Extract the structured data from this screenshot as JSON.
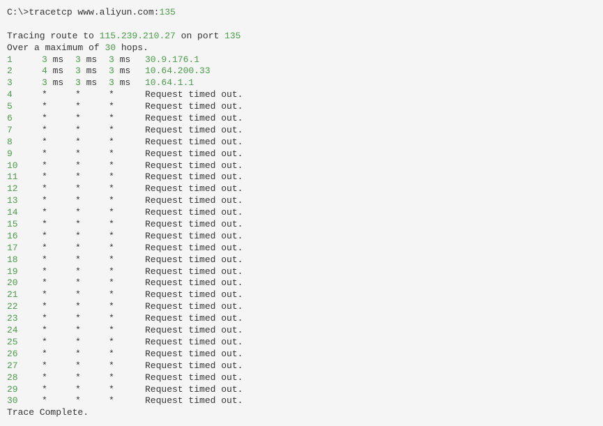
{
  "command": {
    "prompt": "C:\\>",
    "cmd": "tracetcp www.aliyun.com:",
    "port": "135"
  },
  "tracing": {
    "prefix": "Tracing route to ",
    "ip": "115.239.210.27",
    "mid": " on port ",
    "port": "135"
  },
  "maxhops": {
    "prefix": "Over a maximum of ",
    "num": "30",
    "suffix": " hops."
  },
  "hops": [
    {
      "n": "1",
      "c1": "3",
      "u1": "ms",
      "c2": "3",
      "u2": "ms",
      "c3": "3",
      "u3": "ms",
      "r": "30.9.176.1",
      "rg": true
    },
    {
      "n": "2",
      "c1": "4",
      "u1": "ms",
      "c2": "3",
      "u2": "ms",
      "c3": "3",
      "u3": "ms",
      "r": "10.64.200.33",
      "rg": true
    },
    {
      "n": "3",
      "c1": "3",
      "u1": "ms",
      "c2": "3",
      "u2": "ms",
      "c3": "3",
      "u3": "ms",
      "r": "10.64.1.1",
      "rg": true
    },
    {
      "n": "4",
      "c1": "*",
      "u1": "",
      "c2": "*",
      "u2": "",
      "c3": "*",
      "u3": "",
      "r": "Request timed out.",
      "rg": false
    },
    {
      "n": "5",
      "c1": "*",
      "u1": "",
      "c2": "*",
      "u2": "",
      "c3": "*",
      "u3": "",
      "r": "Request timed out.",
      "rg": false
    },
    {
      "n": "6",
      "c1": "*",
      "u1": "",
      "c2": "*",
      "u2": "",
      "c3": "*",
      "u3": "",
      "r": "Request timed out.",
      "rg": false
    },
    {
      "n": "7",
      "c1": "*",
      "u1": "",
      "c2": "*",
      "u2": "",
      "c3": "*",
      "u3": "",
      "r": "Request timed out.",
      "rg": false
    },
    {
      "n": "8",
      "c1": "*",
      "u1": "",
      "c2": "*",
      "u2": "",
      "c3": "*",
      "u3": "",
      "r": "Request timed out.",
      "rg": false
    },
    {
      "n": "9",
      "c1": "*",
      "u1": "",
      "c2": "*",
      "u2": "",
      "c3": "*",
      "u3": "",
      "r": "Request timed out.",
      "rg": false
    },
    {
      "n": "10",
      "c1": "*",
      "u1": "",
      "c2": "*",
      "u2": "",
      "c3": "*",
      "u3": "",
      "r": "Request timed out.",
      "rg": false
    },
    {
      "n": "11",
      "c1": "*",
      "u1": "",
      "c2": "*",
      "u2": "",
      "c3": "*",
      "u3": "",
      "r": "Request timed out.",
      "rg": false
    },
    {
      "n": "12",
      "c1": "*",
      "u1": "",
      "c2": "*",
      "u2": "",
      "c3": "*",
      "u3": "",
      "r": "Request timed out.",
      "rg": false
    },
    {
      "n": "13",
      "c1": "*",
      "u1": "",
      "c2": "*",
      "u2": "",
      "c3": "*",
      "u3": "",
      "r": "Request timed out.",
      "rg": false
    },
    {
      "n": "14",
      "c1": "*",
      "u1": "",
      "c2": "*",
      "u2": "",
      "c3": "*",
      "u3": "",
      "r": "Request timed out.",
      "rg": false
    },
    {
      "n": "15",
      "c1": "*",
      "u1": "",
      "c2": "*",
      "u2": "",
      "c3": "*",
      "u3": "",
      "r": "Request timed out.",
      "rg": false
    },
    {
      "n": "16",
      "c1": "*",
      "u1": "",
      "c2": "*",
      "u2": "",
      "c3": "*",
      "u3": "",
      "r": "Request timed out.",
      "rg": false
    },
    {
      "n": "17",
      "c1": "*",
      "u1": "",
      "c2": "*",
      "u2": "",
      "c3": "*",
      "u3": "",
      "r": "Request timed out.",
      "rg": false
    },
    {
      "n": "18",
      "c1": "*",
      "u1": "",
      "c2": "*",
      "u2": "",
      "c3": "*",
      "u3": "",
      "r": "Request timed out.",
      "rg": false
    },
    {
      "n": "19",
      "c1": "*",
      "u1": "",
      "c2": "*",
      "u2": "",
      "c3": "*",
      "u3": "",
      "r": "Request timed out.",
      "rg": false
    },
    {
      "n": "20",
      "c1": "*",
      "u1": "",
      "c2": "*",
      "u2": "",
      "c3": "*",
      "u3": "",
      "r": "Request timed out.",
      "rg": false
    },
    {
      "n": "21",
      "c1": "*",
      "u1": "",
      "c2": "*",
      "u2": "",
      "c3": "*",
      "u3": "",
      "r": "Request timed out.",
      "rg": false
    },
    {
      "n": "22",
      "c1": "*",
      "u1": "",
      "c2": "*",
      "u2": "",
      "c3": "*",
      "u3": "",
      "r": "Request timed out.",
      "rg": false
    },
    {
      "n": "23",
      "c1": "*",
      "u1": "",
      "c2": "*",
      "u2": "",
      "c3": "*",
      "u3": "",
      "r": "Request timed out.",
      "rg": false
    },
    {
      "n": "24",
      "c1": "*",
      "u1": "",
      "c2": "*",
      "u2": "",
      "c3": "*",
      "u3": "",
      "r": "Request timed out.",
      "rg": false
    },
    {
      "n": "25",
      "c1": "*",
      "u1": "",
      "c2": "*",
      "u2": "",
      "c3": "*",
      "u3": "",
      "r": "Request timed out.",
      "rg": false
    },
    {
      "n": "26",
      "c1": "*",
      "u1": "",
      "c2": "*",
      "u2": "",
      "c3": "*",
      "u3": "",
      "r": "Request timed out.",
      "rg": false
    },
    {
      "n": "27",
      "c1": "*",
      "u1": "",
      "c2": "*",
      "u2": "",
      "c3": "*",
      "u3": "",
      "r": "Request timed out.",
      "rg": false
    },
    {
      "n": "28",
      "c1": "*",
      "u1": "",
      "c2": "*",
      "u2": "",
      "c3": "*",
      "u3": "",
      "r": "Request timed out.",
      "rg": false
    },
    {
      "n": "29",
      "c1": "*",
      "u1": "",
      "c2": "*",
      "u2": "",
      "c3": "*",
      "u3": "",
      "r": "Request timed out.",
      "rg": false
    },
    {
      "n": "30",
      "c1": "*",
      "u1": "",
      "c2": "*",
      "u2": "",
      "c3": "*",
      "u3": "",
      "r": "Request timed out.",
      "rg": false
    }
  ],
  "complete": "Trace Complete."
}
